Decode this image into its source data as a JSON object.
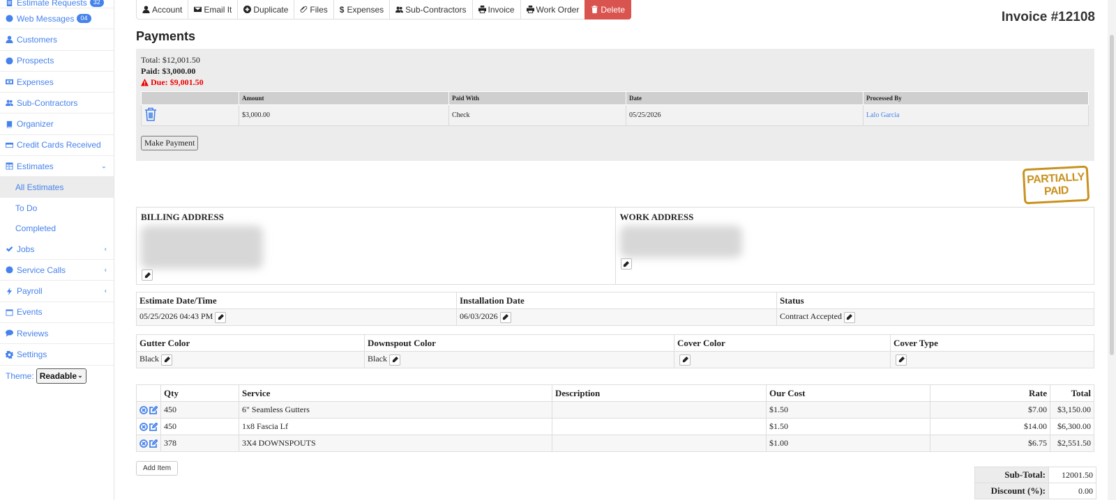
{
  "sidebar": {
    "items": [
      {
        "label": "Estimate Requests",
        "icon": "document-icon",
        "badge": "32"
      },
      {
        "label": "Web Messages",
        "icon": "globe-icon",
        "badge": "04"
      },
      {
        "label": "Customers",
        "icon": "user-icon"
      },
      {
        "label": "Prospects",
        "icon": "info-circle-icon"
      },
      {
        "label": "Expenses",
        "icon": "money-icon"
      },
      {
        "label": "Sub-Contractors",
        "icon": "users-icon"
      },
      {
        "label": "Organizer",
        "icon": "book-icon"
      },
      {
        "label": "Credit Cards Received",
        "icon": "credit-card-icon"
      },
      {
        "label": "Estimates",
        "icon": "table-icon"
      }
    ],
    "estimates_sub": [
      "All Estimates",
      "To Do",
      "Completed"
    ],
    "items2": [
      {
        "label": "Jobs",
        "icon": "check-icon"
      },
      {
        "label": "Service Calls",
        "icon": "info-circle-icon"
      },
      {
        "label": "Payroll",
        "icon": "bolt-icon"
      },
      {
        "label": "Events",
        "icon": "calendar-icon"
      },
      {
        "label": "Reviews",
        "icon": "comment-icon"
      },
      {
        "label": "Settings",
        "icon": "gear-icon"
      }
    ],
    "theme_label": "Theme:",
    "theme_value": "Readable"
  },
  "toolbar": {
    "account": "Account",
    "email": "Email It",
    "duplicate": "Duplicate",
    "files": "Files",
    "expenses": "Expenses",
    "subcontractors": "Sub-Contractors",
    "invoice": "Invoice",
    "work_order": "Work Order",
    "delete": "Delete"
  },
  "invoice_number": "Invoice #12108",
  "payments": {
    "title": "Payments",
    "total": "Total: $12,001.50",
    "paid": "Paid: $3,000.00",
    "due": "Due: $9,001.50",
    "columns": [
      "Amount",
      "Paid With",
      "Date",
      "Processed By"
    ],
    "rows": [
      {
        "amount": "$3,000.00",
        "paid_with": "Check",
        "date": "05/25/2026",
        "processed_by": "Lalo Garcia"
      }
    ],
    "make_payment": "Make Payment"
  },
  "stamp": {
    "line1": "PARTIALLY",
    "line2": "PAID",
    "color": "#c8921e"
  },
  "addresses": {
    "billing_label": "BILLING ADDRESS",
    "work_label": "WORK ADDRESS"
  },
  "info": {
    "estimate_date_label": "Estimate Date/Time",
    "estimate_date": "05/25/2026 04:43 PM",
    "install_label": "Installation Date",
    "install_date": "06/03/2026",
    "status_label": "Status",
    "status": "Contract Accepted"
  },
  "colors": {
    "gutter_label": "Gutter Color",
    "gutter": "Black",
    "downspout_label": "Downspout Color",
    "downspout": "Black",
    "cover_label": "Cover Color",
    "cover": "",
    "cover_type_label": "Cover Type",
    "cover_type": ""
  },
  "items": {
    "columns": {
      "qty": "Qty",
      "service": "Service",
      "description": "Description",
      "our_cost": "Our Cost",
      "rate": "Rate",
      "total": "Total"
    },
    "rows": [
      {
        "qty": "450",
        "service": "6\" Seamless Gutters",
        "description": "",
        "our_cost": "$1.50",
        "rate": "$7.00",
        "total": "$3,150.00"
      },
      {
        "qty": "450",
        "service": "1x8 Fascia Lf",
        "description": "",
        "our_cost": "$1.50",
        "rate": "$14.00",
        "total": "$6,300.00"
      },
      {
        "qty": "378",
        "service": "3X4 DOWNSPOUTS",
        "description": "",
        "our_cost": "$1.00",
        "rate": "$6.75",
        "total": "$2,551.50"
      }
    ],
    "add_item": "Add Item"
  },
  "totals": {
    "subtotal_label": "Sub-Total:",
    "subtotal": "12001.50",
    "discount_label": "Discount (%):",
    "discount": "0.00"
  },
  "accent_color": "#4582ec",
  "danger_color": "#d9534f"
}
